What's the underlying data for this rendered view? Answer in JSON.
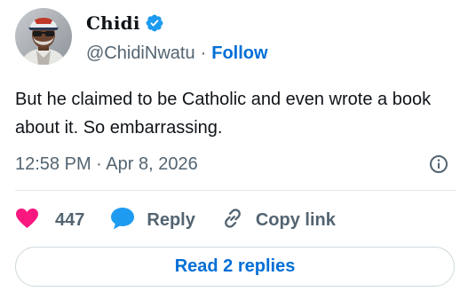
{
  "author": {
    "display_name": "Chidi",
    "handle": "@ChidiNwatu",
    "separator": "·",
    "follow_label": "Follow",
    "verified_icon": "verified-badge-icon"
  },
  "tweet": {
    "text": "But he claimed to be Catholic and even wrote a book about it. So embarrassing.",
    "time": "12:58 PM",
    "meta_separator": "·",
    "date": "Apr 8, 2026"
  },
  "actions": {
    "likes_count": "447",
    "reply_label": "Reply",
    "copy_link_label": "Copy link"
  },
  "footer": {
    "read_replies_label": "Read 2 replies"
  },
  "colors": {
    "accent": "#006fd6",
    "like": "#f91880",
    "muted": "#536471",
    "text": "#0f1419",
    "verified": "#1d9bf0"
  }
}
